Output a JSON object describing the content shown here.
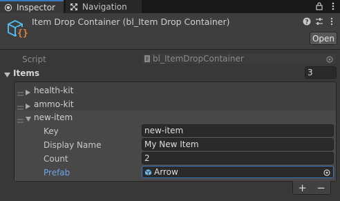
{
  "tabs": [
    {
      "label": "Inspector",
      "active": true
    },
    {
      "label": "Navigation",
      "active": false
    }
  ],
  "component": {
    "title": "Item Drop Container (bl_Item Drop Container)",
    "open_label": "Open"
  },
  "script": {
    "label": "Script",
    "value": "bl_ItemDropContainer"
  },
  "items": {
    "label": "Items",
    "count": "3",
    "elements": [
      {
        "name": "health-kit",
        "expanded": false
      },
      {
        "name": "ammo-kit",
        "expanded": false
      },
      {
        "name": "new-item",
        "expanded": true
      }
    ]
  },
  "new_item": {
    "key_label": "Key",
    "key_value": "new-item",
    "display_name_label": "Display Name",
    "display_name_value": "My New Item",
    "count_label": "Count",
    "count_value": "2",
    "prefab_label": "Prefab",
    "prefab_value": "Arrow"
  },
  "list_buttons": {
    "add": "+",
    "remove": "−"
  },
  "colors": {
    "accent": "#3a79bb",
    "prefab_label": "#6ea6e8",
    "icon_cyan": "#4fb8e8",
    "icon_orange": "#e8803a"
  },
  "icons": [
    "inspector-icon",
    "navigation-icon",
    "lock-icon",
    "more-icon",
    "component-icon",
    "help-icon",
    "presets-icon",
    "menu-icon",
    "script-icon",
    "object-picker-icon",
    "prefab-icon",
    "drag-handle-icon",
    "foldout-arrow-icon"
  ]
}
